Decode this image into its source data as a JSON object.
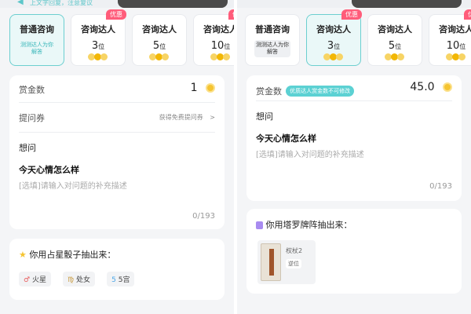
{
  "left": {
    "notice": {
      "text": "上文字回复，注意复议"
    },
    "options": [
      {
        "title": "普通咨询",
        "count": "",
        "unit": "",
        "sub": "测测达人为你解答",
        "badge": ""
      },
      {
        "title": "咨询达人",
        "count": "3",
        "unit": "位",
        "sub": "",
        "badge": "优惠"
      },
      {
        "title": "咨询达人",
        "count": "5",
        "unit": "位",
        "sub": "",
        "badge": ""
      },
      {
        "title": "咨询达人",
        "count": "10",
        "unit": "位",
        "sub": "",
        "badge": "优惠"
      }
    ],
    "reward": {
      "label": "赏金数",
      "value": "1"
    },
    "coupon": {
      "label": "提问券",
      "link": "获得免费提问券",
      "arrow": ">"
    },
    "question": {
      "label": "想问",
      "text": "今天心情怎么样",
      "placeholder": "[选填]请输入对问题的补充描述",
      "counter": "0/193"
    },
    "dice": {
      "title": "你用占星骰子抽出来：",
      "chips": [
        {
          "icon": "♂",
          "label": "火星"
        },
        {
          "icon": "♍",
          "label": "处女"
        },
        {
          "icon": "5",
          "label": "5宫"
        }
      ]
    }
  },
  "right": {
    "options": [
      {
        "title": "普通咨询",
        "count": "",
        "unit": "",
        "sub": "测测达人为你解答",
        "badge": ""
      },
      {
        "title": "咨询达人",
        "count": "3",
        "unit": "位",
        "sub": "",
        "badge": "优惠"
      },
      {
        "title": "咨询达人",
        "count": "5",
        "unit": "位",
        "sub": "",
        "badge": ""
      },
      {
        "title": "咨询达人",
        "count": "10",
        "unit": "位",
        "sub": "",
        "badge": "优惠"
      }
    ],
    "reward": {
      "label": "赏金数",
      "pill": "优质达人赏金数不可修改",
      "value": "45.0"
    },
    "question": {
      "label": "想问",
      "text": "今天心情怎么样",
      "placeholder": "[选填]请输入对问题的补充描述",
      "counter": "0/193"
    },
    "tarot": {
      "title": "你用塔罗牌阵抽出来：",
      "card_name": "权杖2",
      "card_state": "逆位"
    }
  }
}
